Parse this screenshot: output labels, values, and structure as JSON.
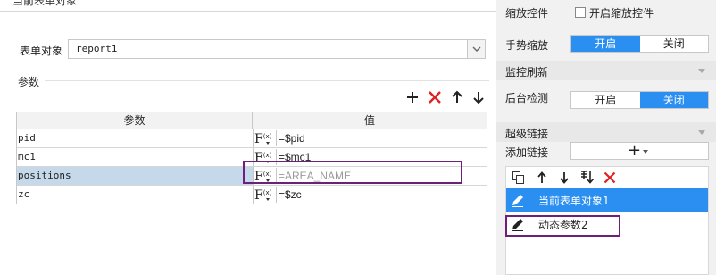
{
  "left": {
    "top_title": "当前表单对象",
    "form_object": {
      "label": "表单对象",
      "value": "report1"
    },
    "params_group_label": "参数",
    "toolbar": [
      {
        "name": "add-icon",
        "glyph": "+"
      },
      {
        "name": "delete-icon",
        "glyph": "✕",
        "color": "#e02020"
      },
      {
        "name": "move-up-icon",
        "glyph": "↑"
      },
      {
        "name": "move-down-icon",
        "glyph": "↓"
      }
    ],
    "table": {
      "headers": {
        "name": "参数",
        "value": "值"
      },
      "rows": [
        {
          "name": "pid",
          "value": "=$pid",
          "muted": false,
          "selected": false
        },
        {
          "name": "mc1",
          "value": "=$mc1",
          "muted": false,
          "selected": false
        },
        {
          "name": "positions",
          "value": "=AREA_NAME",
          "muted": true,
          "selected": true
        },
        {
          "name": "zc",
          "value": "=$zc",
          "muted": false,
          "selected": false
        }
      ]
    }
  },
  "right": {
    "zoom_control": {
      "label": "缩放控件",
      "checkbox_label": "开启缩放控件",
      "checked": false
    },
    "gesture_zoom": {
      "label": "手势缩放",
      "on_label": "开启",
      "off_label": "关闭",
      "selected": "on"
    },
    "monitor_refresh": {
      "label": "监控刷新"
    },
    "background_detect": {
      "label": "后台检测",
      "on_label": "开启",
      "off_label": "关闭",
      "selected": "off"
    },
    "hyperlink": {
      "label": "超级链接"
    },
    "add_link": {
      "label": "添加链接",
      "button_glyph": "+"
    },
    "link_list": {
      "items": [
        {
          "label": "当前表单对象1",
          "selected": true
        },
        {
          "label": "动态参数2",
          "selected": false
        }
      ]
    }
  },
  "colors": {
    "accent": "#2a8ff0",
    "highlight_box": "#6d1f79",
    "selected_row": "#c5d9ea",
    "delete": "#e02020"
  }
}
